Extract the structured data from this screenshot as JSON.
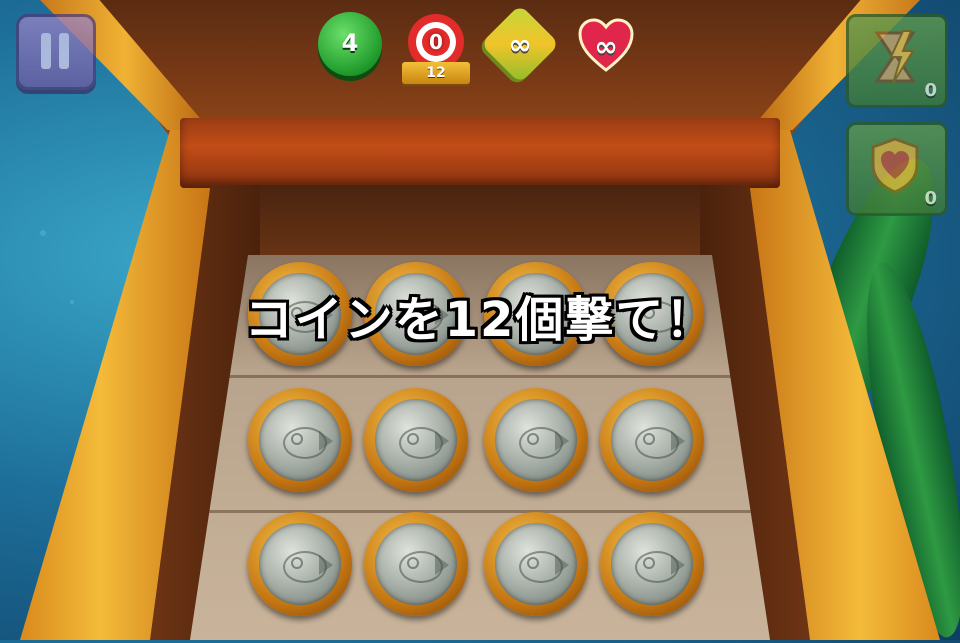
{
  "hud": {
    "moves": "4",
    "target_collected": "0",
    "target_goal": "12",
    "boost_value": "∞",
    "lives_value": "∞"
  },
  "powerups": [
    {
      "name": "hourglass-bolt",
      "count": "0"
    },
    {
      "name": "heart-shield",
      "count": "0"
    }
  ],
  "banner": {
    "text": "コインを12個撃て！"
  },
  "board": {
    "rows": 3,
    "cols": 4,
    "item": "fish-coin"
  },
  "colors": {
    "moves_green": "#1f9a2a",
    "target_red": "#e22b2b",
    "heart_red": "#d71f45",
    "coin_gold": "#c57712",
    "coin_silver": "#9aa39b",
    "chest_wood": "#c24d17"
  }
}
